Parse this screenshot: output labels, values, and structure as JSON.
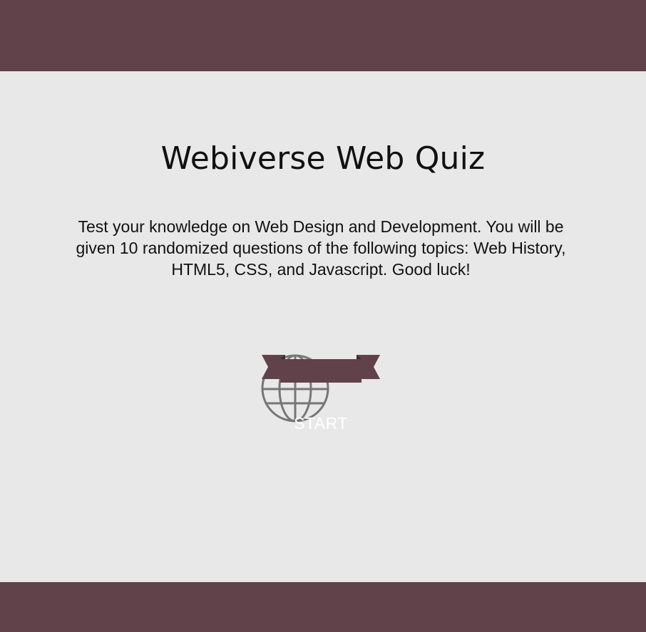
{
  "quiz": {
    "title": "Webiverse Web Quiz",
    "description": "Test your knowledge on Web Design and Development. You will be given 10 randomized questions of the following topics: Web History, HTML5, CSS, and Javascript. Good luck!",
    "start_label": "START"
  },
  "theme": {
    "bar_color": "#61424a",
    "background_color": "#e9e8e8",
    "ribbon_color": "#61424a",
    "ribbon_fold_color": "#3f2a30",
    "globe_color": "#767676"
  },
  "icons": {
    "globe": "globe-icon",
    "ribbon": "ribbon-icon"
  }
}
